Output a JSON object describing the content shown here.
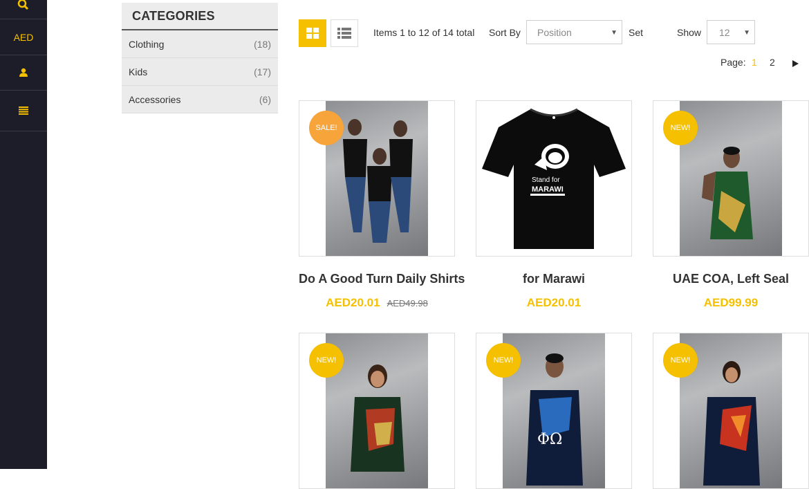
{
  "rail": {
    "currency": "AED"
  },
  "categories": {
    "title": "CATEGORIES",
    "items": [
      {
        "label": "Clothing",
        "count": "(18)"
      },
      {
        "label": "Kids",
        "count": "(17)"
      },
      {
        "label": "Accessories",
        "count": "(6)"
      }
    ]
  },
  "toolbar": {
    "items_text": "Items 1 to 12 of 14 total",
    "sort_label": "Sort By",
    "sort_value": "Position",
    "set_label": "Set",
    "show_label": "Show",
    "show_value": "12",
    "page_label": "Page:",
    "page_current": "1",
    "page_next_num": "2"
  },
  "products": [
    {
      "badge": "SALE!",
      "badge_type": "sale",
      "name": "Do A Good Turn Daily Shirts",
      "price": "AED20.01",
      "old_price": "AED49.98"
    },
    {
      "badge": "",
      "badge_type": "",
      "name": "for Marawi",
      "price": "AED20.01",
      "old_price": ""
    },
    {
      "badge": "NEW!",
      "badge_type": "new",
      "name": "UAE COA, Left Seal",
      "price": "AED99.99",
      "old_price": ""
    },
    {
      "badge": "NEW!",
      "badge_type": "new",
      "name": "",
      "price": "",
      "old_price": ""
    },
    {
      "badge": "NEW!",
      "badge_type": "new",
      "name": "",
      "price": "",
      "old_price": ""
    },
    {
      "badge": "NEW!",
      "badge_type": "new",
      "name": "",
      "price": "",
      "old_price": ""
    }
  ],
  "tshirt_print": {
    "line1": "Stand for",
    "line2": "MARAWI"
  },
  "colors": {
    "accent": "#f5c000",
    "sale_badge": "#f7a43a",
    "rail_bg": "#1c1d28"
  }
}
